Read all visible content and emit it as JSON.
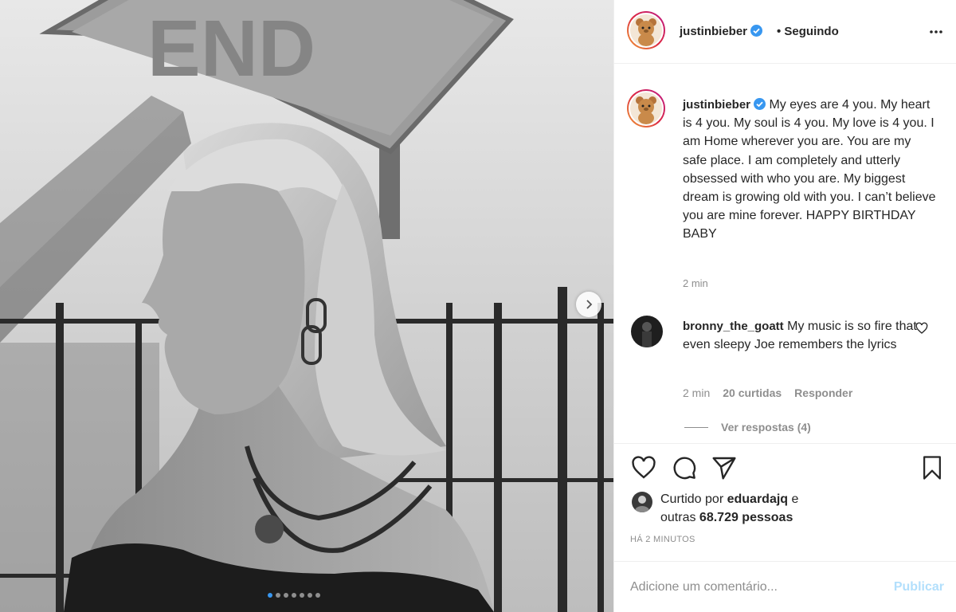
{
  "header": {
    "username": "justinbieber",
    "follow_status": "• Seguindo"
  },
  "caption": {
    "username": "justinbieber",
    "text": "My eyes are 4 you. My heart is 4 you. My soul is 4 you. My love is 4 you. I am Home wherever you are. You are my safe place. I am completely and utterly obsessed with who you are. My biggest dream is growing old with you. I can’t believe you are mine forever. HAPPY BIRTHDAY BABY",
    "time": "2 min"
  },
  "photo": {
    "sign_text": "END",
    "carousel_count": 7,
    "carousel_active": 0
  },
  "comment": {
    "username": "bronny_the_goatt",
    "text": "My music is so fire that even sleepy Joe remembers the lyrics",
    "time": "2 min",
    "likes": "20 curtidas",
    "reply": "Responder",
    "view_replies": "Ver respostas (4)"
  },
  "likes": {
    "prefix": "Curtido por ",
    "user": "eduardajq",
    "suffix": " e",
    "line2_prefix": "outras ",
    "count": "68.729 pessoas"
  },
  "timestamp": "HÁ 2 MINUTOS",
  "add_comment": {
    "placeholder": "Adicione um comentário...",
    "publish": "Publicar"
  },
  "colors": {
    "verified": "#3897f0",
    "publish_disabled": "#b2dffc",
    "muted": "#8e8e8e"
  }
}
